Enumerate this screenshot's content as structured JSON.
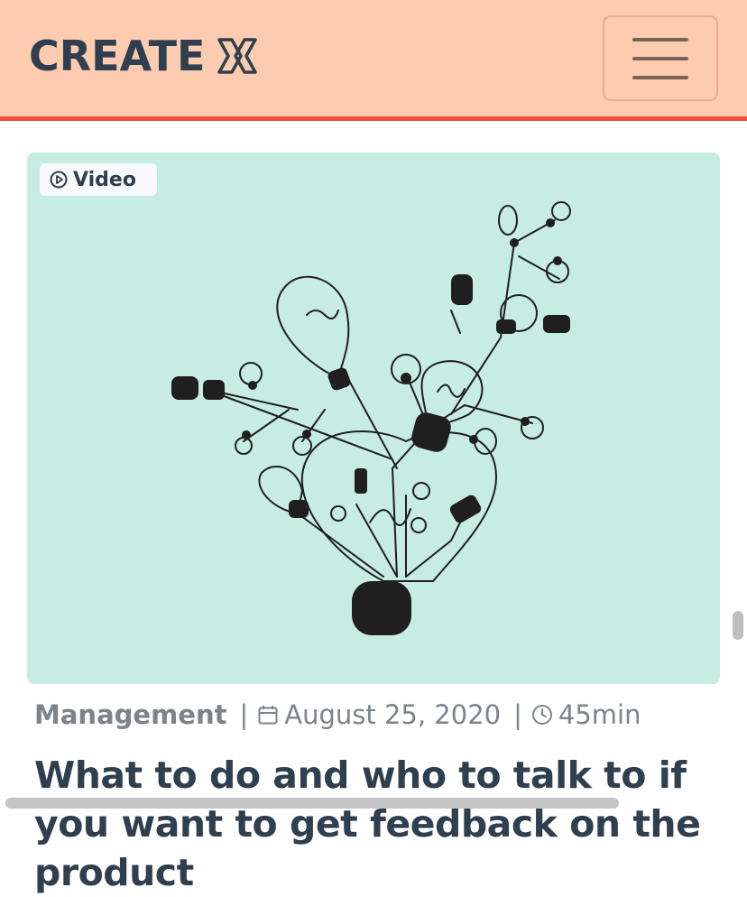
{
  "header": {
    "logo_text": "CREATE",
    "logo_mark_icon": "create-x-logo-mark",
    "menu_icon": "hamburger-menu-icon",
    "background": "#fdcbb0",
    "accent_border": "#f04d3b"
  },
  "card": {
    "badge_label": "Video",
    "badge_icon": "play-circle-icon",
    "image_background": "#c7ece1",
    "image_subject": "light-bulb-illustration",
    "category": "Management",
    "date": "August 25, 2020",
    "duration": "45min",
    "title": "What to do and who to talk to if you want to get feedback on the product"
  }
}
